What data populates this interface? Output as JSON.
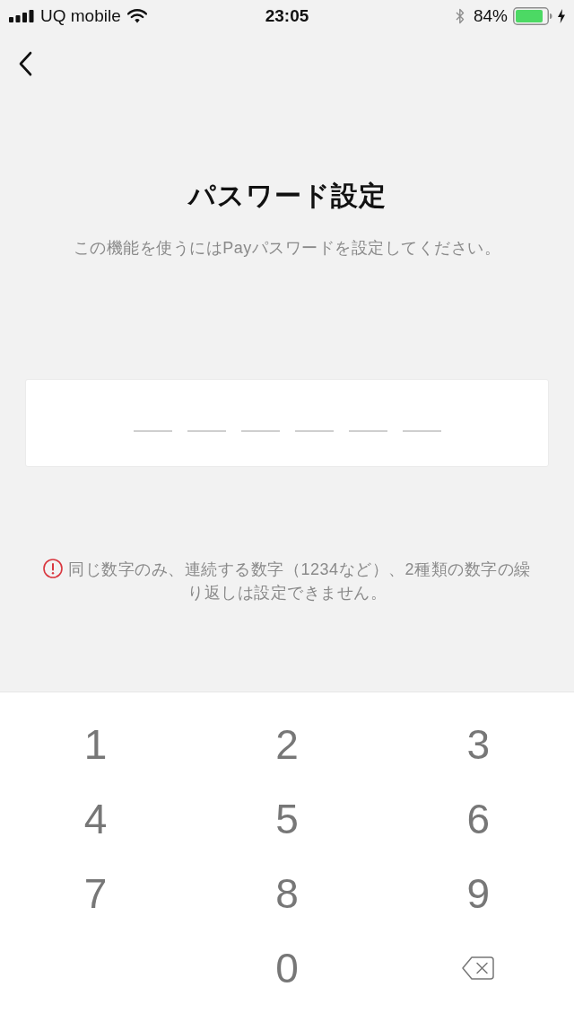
{
  "status_bar": {
    "carrier": "UQ mobile",
    "time": "23:05",
    "battery": "84%",
    "charging": true
  },
  "title": "パスワード設定",
  "subtitle": "この機能を使うにはPayパスワードを設定してください。",
  "pin_field": {
    "slots": [
      {
        "filled": false
      },
      {
        "filled": false
      },
      {
        "filled": false
      },
      {
        "filled": false
      },
      {
        "filled": false
      },
      {
        "filled": false
      }
    ]
  },
  "notice": {
    "text": "同じ数字のみ、連続する数字（1234など）、2種類の数字の繰り返しは設定できません。"
  },
  "keypad": {
    "keys": [
      {
        "kind": "digit",
        "label": "1"
      },
      {
        "kind": "digit",
        "label": "2"
      },
      {
        "kind": "digit",
        "label": "3"
      },
      {
        "kind": "digit",
        "label": "4"
      },
      {
        "kind": "digit",
        "label": "5"
      },
      {
        "kind": "digit",
        "label": "6"
      },
      {
        "kind": "digit",
        "label": "7"
      },
      {
        "kind": "digit",
        "label": "8"
      },
      {
        "kind": "digit",
        "label": "9"
      },
      {
        "kind": "digit",
        "label": "0"
      },
      {
        "kind": "backspace"
      }
    ]
  }
}
